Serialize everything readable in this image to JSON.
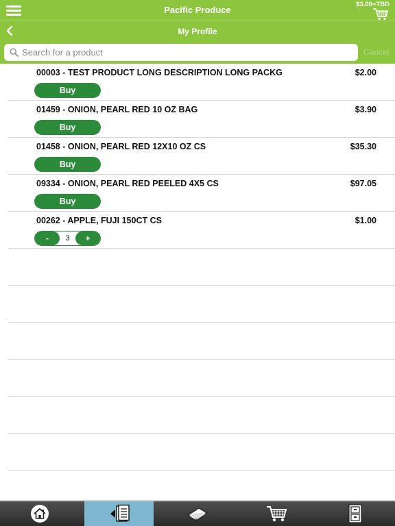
{
  "header": {
    "app_title": "Pacific Produce",
    "cart_total": "$3.00+TBD",
    "page_title": "My Profile"
  },
  "search": {
    "placeholder": "Search for a product",
    "value": "",
    "cancel_label": "Cancel"
  },
  "products": [
    {
      "name": "00003 - TEST PRODUCT LONG DESCRIPTION LONG PACKG",
      "price": "$2.00",
      "action": "Buy"
    },
    {
      "name": "01459 - ONION, PEARL RED 10 OZ BAG",
      "price": "$3.90",
      "action": "Buy"
    },
    {
      "name": "01458 - ONION, PEARL RED 12X10 OZ CS",
      "price": "$35.30",
      "action": "Buy"
    },
    {
      "name": "09334 - ONION, PEARL RED PEELED 4X5 CS",
      "price": "$97.05",
      "action": "Buy"
    },
    {
      "name": "00262 - APPLE, FUJI 150CT CS",
      "price": "$1.00",
      "quantity": "3",
      "minus_label": "-",
      "plus_label": "+"
    }
  ],
  "empty_rows": 6,
  "tabs": [
    {
      "icon": "home-icon",
      "active": false
    },
    {
      "icon": "order-guide-icon",
      "active": true
    },
    {
      "icon": "catalog-book-icon",
      "active": false
    },
    {
      "icon": "cart-icon",
      "active": false
    },
    {
      "icon": "cabinet-icon",
      "active": false
    }
  ],
  "colors": {
    "brand_green": "#8cc63f",
    "button_green": "#2c8b3a",
    "active_tab": "#7fb6d0"
  }
}
